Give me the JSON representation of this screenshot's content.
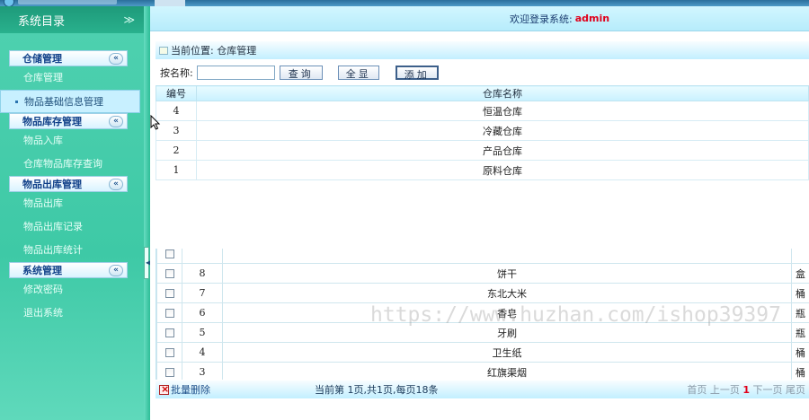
{
  "window": {
    "title_text": ""
  },
  "sidebar": {
    "header": "系统目录",
    "groups": [
      {
        "title": "仓储管理",
        "items": [
          "仓库管理",
          "物品基础信息管理"
        ]
      },
      {
        "title": "物品库存管理",
        "items": [
          "物品入库",
          "仓库物品库存查询"
        ]
      },
      {
        "title": "物品出库管理",
        "items": [
          "物品出库",
          "物品出库记录",
          "物品出库统计"
        ]
      },
      {
        "title": "系统管理",
        "items": [
          "修改密码",
          "退出系统"
        ]
      }
    ],
    "collapse_glyph": "«",
    "header_glyph": "≫"
  },
  "header": {
    "welcome": "欢迎登录系统:",
    "user": "admin"
  },
  "breadcrumb": "当前位置: 仓库管理",
  "search": {
    "label": "按名称:",
    "value": "",
    "query_btn": "查询",
    "all_btn": "全显",
    "add_btn": "添加"
  },
  "warehouse_table": {
    "headers": [
      "编号",
      "仓库名称"
    ],
    "rows": [
      {
        "id": "4",
        "name": "恒温仓库"
      },
      {
        "id": "3",
        "name": "冷藏仓库"
      },
      {
        "id": "2",
        "name": "产品仓库"
      },
      {
        "id": "1",
        "name": "原料仓库"
      }
    ]
  },
  "goods_table": {
    "rows": [
      {
        "id": "8",
        "name": "饼干",
        "unit": "盒"
      },
      {
        "id": "7",
        "name": "东北大米",
        "unit": "桶"
      },
      {
        "id": "6",
        "name": "香皂",
        "unit": "瓶"
      },
      {
        "id": "5",
        "name": "牙刷",
        "unit": "瓶"
      },
      {
        "id": "4",
        "name": "卫生纸",
        "unit": "桶"
      },
      {
        "id": "3",
        "name": "红旗渠烟",
        "unit": "桶"
      }
    ]
  },
  "footer": {
    "batch_delete": "批量删除",
    "info": "当前第 1页,共1页,每页18条",
    "pager": {
      "first": "首页",
      "prev": "上一页",
      "current": "1",
      "next": "下一页",
      "last": "尾页"
    }
  },
  "watermark": "https://www.huzhan.com/ishop39397"
}
